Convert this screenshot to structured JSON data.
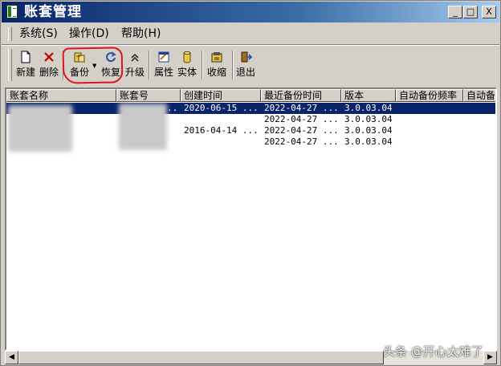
{
  "window": {
    "title": "账套管理",
    "controls": {
      "minimize": "_",
      "maximize": "□",
      "close": "X"
    }
  },
  "menu": {
    "items": [
      {
        "label": "系统(S)"
      },
      {
        "label": "操作(D)"
      },
      {
        "label": "帮助(H)"
      }
    ]
  },
  "toolbar": {
    "new": "新建",
    "delete": "删除",
    "backup": "备份",
    "restore": "恢复",
    "upgrade": "升级",
    "properties": "属性",
    "entity": "实体",
    "shrink": "收缩",
    "exit": "退出"
  },
  "list": {
    "columns": [
      "账套名称",
      "账套号",
      "创建时间",
      "最近备份时间",
      "版本",
      "自动备份频率",
      "自动备"
    ],
    "rows": [
      {
        "created": "2020-06-15 ...",
        "last_backup": "2022-04-27 ...",
        "version": "3.0.03.04",
        "selected": true
      },
      {
        "created": "",
        "last_backup": "2022-04-27 ...",
        "version": "3.0.03.04",
        "selected": false
      },
      {
        "created": "2016-04-14 ...",
        "last_backup": "2022-04-27 ...",
        "version": "3.0.03.04",
        "selected": false
      },
      {
        "created": "",
        "last_backup": "2022-04-27 ...",
        "version": "3.0.03.04",
        "selected": false
      }
    ],
    "col0_trunc": ".."
  },
  "scrollbar": {
    "left_arrow": "◀",
    "right_arrow": "▶"
  },
  "watermark": "头条 @开心太难了",
  "colors": {
    "selection": "#0a246a",
    "titlebar": "#0a246a",
    "annotation": "#e0151b"
  }
}
